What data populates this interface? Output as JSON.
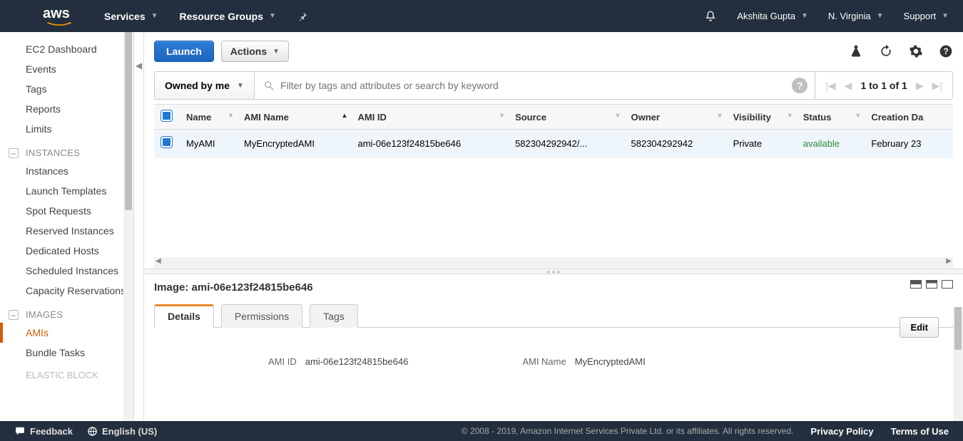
{
  "nav": {
    "logo": "aws",
    "services": "Services",
    "resource_groups": "Resource Groups",
    "user": "Akshita Gupta",
    "region": "N. Virginia",
    "support": "Support"
  },
  "sidebar": {
    "top_links": [
      "EC2 Dashboard",
      "Events",
      "Tags",
      "Reports",
      "Limits"
    ],
    "sections": [
      {
        "title": "INSTANCES",
        "links": [
          "Instances",
          "Launch Templates",
          "Spot Requests",
          "Reserved Instances",
          "Dedicated Hosts",
          "Scheduled Instances",
          "Capacity Reservations"
        ]
      },
      {
        "title": "IMAGES",
        "links": [
          "AMIs",
          "Bundle Tasks"
        ]
      }
    ],
    "cutoff": "ELASTIC BLOCK"
  },
  "toolbar": {
    "launch": "Launch",
    "actions": "Actions"
  },
  "filter": {
    "owned": "Owned by me",
    "placeholder": "Filter by tags and attributes or search by keyword",
    "range": "1 to 1 of 1"
  },
  "table": {
    "headers": [
      "Name",
      "AMI Name",
      "AMI ID",
      "Source",
      "Owner",
      "Visibility",
      "Status",
      "Creation Da"
    ],
    "rows": [
      {
        "name": "MyAMI",
        "ami_name": "MyEncryptedAMI",
        "ami_id": "ami-06e123f24815be646",
        "source": "582304292942/...",
        "owner": "582304292942",
        "visibility": "Private",
        "status": "available",
        "creation": "February 23"
      }
    ]
  },
  "details": {
    "title": "Image: ami-06e123f24815be646",
    "tabs": [
      "Details",
      "Permissions",
      "Tags"
    ],
    "edit": "Edit",
    "fields": {
      "ami_id_label": "AMI ID",
      "ami_id_value": "ami-06e123f24815be646",
      "ami_name_label": "AMI Name",
      "ami_name_value": "MyEncryptedAMI"
    }
  },
  "footer": {
    "feedback": "Feedback",
    "language": "English (US)",
    "copyright": "© 2008 - 2019, Amazon Internet Services Private Ltd. or its affiliates. All rights reserved.",
    "privacy": "Privacy Policy",
    "terms": "Terms of Use"
  }
}
